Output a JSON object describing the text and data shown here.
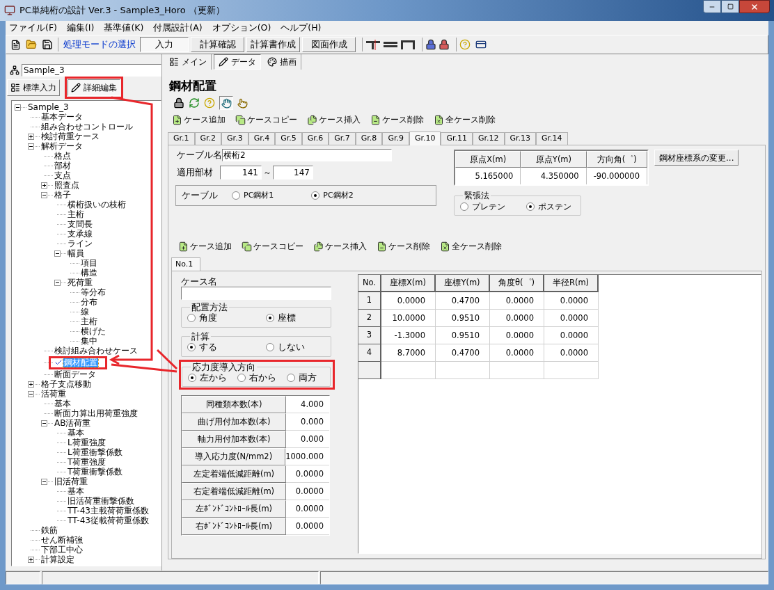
{
  "window": {
    "title": "PC単純桁の設計 Ver.3 - Sample3_Horo （更新）"
  },
  "menu": [
    "ファイル(F)",
    "編集(I)",
    "基準値(K)",
    "付属設計(A)",
    "オプション(O)",
    "ヘルプ(H)"
  ],
  "toolbar": {
    "mode_label": "処理モードの選択",
    "modes": [
      {
        "label": "入力",
        "selected": true
      },
      {
        "label": "計算確認",
        "selected": false
      },
      {
        "label": "計算書作成",
        "selected": false
      },
      {
        "label": "図面作成",
        "selected": false
      }
    ]
  },
  "left_panel": {
    "project": "Sample_3",
    "view_buttons": [
      {
        "label": "標準入力",
        "selected": false
      },
      {
        "label": "詳細編集",
        "selected": true
      }
    ],
    "tree": [
      {
        "label": "Sample_3",
        "kind": "branch",
        "expanded": true,
        "selected": false,
        "checked": false,
        "children": [
          {
            "label": "基本データ",
            "kind": "leaf",
            "selected": false,
            "checked": false
          },
          {
            "label": "組み合わせコントロール",
            "kind": "leaf",
            "selected": false,
            "checked": false
          },
          {
            "label": "検討荷重ケース",
            "kind": "branch",
            "expanded": false,
            "selected": false,
            "checked": false
          },
          {
            "label": "解析データ",
            "kind": "branch",
            "expanded": true,
            "selected": false,
            "checked": false,
            "children": [
              {
                "label": "格点",
                "kind": "leaf",
                "selected": false,
                "checked": false
              },
              {
                "label": "部材",
                "kind": "leaf",
                "selected": false,
                "checked": false
              },
              {
                "label": "支点",
                "kind": "leaf",
                "selected": false,
                "checked": false
              },
              {
                "label": "照査点",
                "kind": "branch",
                "expanded": false,
                "selected": false,
                "checked": false
              },
              {
                "label": "格子",
                "kind": "branch",
                "expanded": true,
                "selected": false,
                "checked": false,
                "children": [
                  {
                    "label": "横桁扱いの枝桁",
                    "kind": "leaf",
                    "selected": false,
                    "checked": false
                  },
                  {
                    "label": "主桁",
                    "kind": "leaf",
                    "selected": false,
                    "checked": false
                  },
                  {
                    "label": "支間長",
                    "kind": "leaf",
                    "selected": false,
                    "checked": false
                  },
                  {
                    "label": "支承線",
                    "kind": "leaf",
                    "selected": false,
                    "checked": false
                  },
                  {
                    "label": "ライン",
                    "kind": "leaf",
                    "selected": false,
                    "checked": false
                  },
                  {
                    "label": "幅員",
                    "kind": "branch",
                    "expanded": true,
                    "selected": false,
                    "checked": false,
                    "children": [
                      {
                        "label": "項目",
                        "kind": "leaf",
                        "selected": false,
                        "checked": false
                      },
                      {
                        "label": "構造",
                        "kind": "leaf",
                        "selected": false,
                        "checked": false
                      }
                    ]
                  },
                  {
                    "label": "死荷重",
                    "kind": "branch",
                    "expanded": true,
                    "selected": false,
                    "checked": false,
                    "children": [
                      {
                        "label": "等分布",
                        "kind": "leaf",
                        "selected": false,
                        "checked": false
                      },
                      {
                        "label": "分布",
                        "kind": "leaf",
                        "selected": false,
                        "checked": false
                      },
                      {
                        "label": "線",
                        "kind": "leaf",
                        "selected": false,
                        "checked": false
                      },
                      {
                        "label": "主桁",
                        "kind": "leaf",
                        "selected": false,
                        "checked": false
                      },
                      {
                        "label": "横げた",
                        "kind": "leaf",
                        "selected": false,
                        "checked": false
                      },
                      {
                        "label": "集中",
                        "kind": "leaf",
                        "selected": false,
                        "checked": false
                      }
                    ]
                  }
                ]
              },
              {
                "label": "検討組み合わせケース",
                "kind": "leaf",
                "selected": false,
                "checked": false
              },
              {
                "label": "鋼材配置",
                "kind": "leaf",
                "selected": true,
                "checked": true
              },
              {
                "label": "断面データ",
                "kind": "leaf",
                "selected": false,
                "checked": false
              }
            ]
          },
          {
            "label": "格子支点移動",
            "kind": "branch",
            "expanded": false,
            "selected": false,
            "checked": false
          },
          {
            "label": "活荷重",
            "kind": "branch",
            "expanded": true,
            "selected": false,
            "checked": false,
            "children": [
              {
                "label": "基本",
                "kind": "leaf",
                "selected": false,
                "checked": false
              },
              {
                "label": "断面力算出用荷重強度",
                "kind": "leaf",
                "selected": false,
                "checked": false
              },
              {
                "label": "AB活荷重",
                "kind": "branch",
                "expanded": true,
                "selected": false,
                "checked": false,
                "children": [
                  {
                    "label": "基本",
                    "kind": "leaf",
                    "selected": false,
                    "checked": false
                  },
                  {
                    "label": "L荷重強度",
                    "kind": "leaf",
                    "selected": false,
                    "checked": false
                  },
                  {
                    "label": "L荷重衝撃係数",
                    "kind": "leaf",
                    "selected": false,
                    "checked": false
                  },
                  {
                    "label": "T荷重強度",
                    "kind": "leaf",
                    "selected": false,
                    "checked": false
                  },
                  {
                    "label": "T荷重衝撃係数",
                    "kind": "leaf",
                    "selected": false,
                    "checked": false
                  }
                ]
              },
              {
                "label": "旧活荷重",
                "kind": "branch",
                "expanded": true,
                "selected": false,
                "checked": false,
                "children": [
                  {
                    "label": "基本",
                    "kind": "leaf",
                    "selected": false,
                    "checked": false
                  },
                  {
                    "label": "旧活荷重衝撃係数",
                    "kind": "leaf",
                    "selected": false,
                    "checked": false
                  },
                  {
                    "label": "TT-43主載荷荷重係数",
                    "kind": "leaf",
                    "selected": false,
                    "checked": false
                  },
                  {
                    "label": "TT-43従載荷荷重係数",
                    "kind": "leaf",
                    "selected": false,
                    "checked": false
                  }
                ]
              }
            ]
          },
          {
            "label": "鉄筋",
            "kind": "leaf",
            "selected": false,
            "checked": false
          },
          {
            "label": "せん断補強",
            "kind": "leaf",
            "selected": false,
            "checked": false
          },
          {
            "label": "下部工中心",
            "kind": "leaf",
            "selected": false,
            "checked": false
          },
          {
            "label": "計算設定",
            "kind": "branch",
            "expanded": false,
            "selected": false,
            "checked": false
          }
        ]
      }
    ]
  },
  "main_tabs": [
    {
      "label": "メイン",
      "selected": false
    },
    {
      "label": "データ",
      "selected": true
    },
    {
      "label": "描画",
      "selected": false
    }
  ],
  "section_title": "鋼材配置",
  "case_toolbar": [
    "ケース追加",
    "ケースコピー",
    "ケース挿入",
    "ケース削除",
    "全ケース削除"
  ],
  "group_tabs": [
    {
      "label": "Gr.1",
      "selected": false
    },
    {
      "label": "Gr.2",
      "selected": false
    },
    {
      "label": "Gr.3",
      "selected": false
    },
    {
      "label": "Gr.4",
      "selected": false
    },
    {
      "label": "Gr.5",
      "selected": false
    },
    {
      "label": "Gr.6",
      "selected": false
    },
    {
      "label": "Gr.7",
      "selected": false
    },
    {
      "label": "Gr.8",
      "selected": false
    },
    {
      "label": "Gr.9",
      "selected": false
    },
    {
      "label": "Gr.10",
      "selected": true
    },
    {
      "label": "Gr.11",
      "selected": false
    },
    {
      "label": "Gr.12",
      "selected": false
    },
    {
      "label": "Gr.13",
      "selected": false
    },
    {
      "label": "Gr.14",
      "selected": false
    }
  ],
  "cable_name": {
    "label": "ケーブル名",
    "value": "横桁2"
  },
  "members": {
    "label": "適用部材",
    "from": "141",
    "separator": "～",
    "to": "147"
  },
  "cable": {
    "label": "ケーブル",
    "options": [
      {
        "label": "PC鋼材1",
        "selected": false
      },
      {
        "label": "PC鋼材2",
        "selected": true
      }
    ]
  },
  "origin_table": {
    "columns": [
      "原点X(m)",
      "原点Y(m)",
      "方向角(゜)"
    ],
    "values": [
      "5.165000",
      "4.350000",
      "-90.000000"
    ]
  },
  "change_button": "鋼材座標系の変更...",
  "tension": {
    "title": "緊張法",
    "options": [
      {
        "label": "プレテン",
        "selected": false
      },
      {
        "label": "ポステン",
        "selected": true
      }
    ]
  },
  "case_toolbar_2": [
    "ケース追加",
    "ケースコピー",
    "ケース挿入",
    "ケース削除",
    "全ケース削除"
  ],
  "case_tabs": [
    {
      "label": "No.1",
      "selected": true
    }
  ],
  "case_name": {
    "label": "ケース名"
  },
  "placement": {
    "title": "配置方法",
    "options": [
      {
        "label": "角度",
        "selected": false
      },
      {
        "label": "座標",
        "selected": true
      }
    ]
  },
  "calculation": {
    "title": "計算",
    "options": [
      {
        "label": "する",
        "selected": true
      },
      {
        "label": "しない",
        "selected": false
      }
    ]
  },
  "direction": {
    "title": "応力度導入方向",
    "options": [
      {
        "label": "左から",
        "selected": true
      },
      {
        "label": "右から",
        "selected": false
      },
      {
        "label": "両方",
        "selected": false
      }
    ]
  },
  "properties": [
    {
      "label": "同種類本数(本)",
      "value": "4.000"
    },
    {
      "label": "曲げ用付加本数(本)",
      "value": "0.000"
    },
    {
      "label": "軸力用付加本数(本)",
      "value": "0.000"
    },
    {
      "label": "導入応力度(N/mm2)",
      "value": "1000.000"
    },
    {
      "label": "左定着端低減距離(m)",
      "value": "0.0000"
    },
    {
      "label": "右定着端低減距離(m)",
      "value": "0.0000"
    },
    {
      "label": "左ﾎﾞﾝﾄﾞｺﾝﾄﾛｰﾙ長(m)",
      "value": "0.0000"
    },
    {
      "label": "右ﾎﾞﾝﾄﾞｺﾝﾄﾛｰﾙ長(m)",
      "value": "0.0000"
    }
  ],
  "coords_table": {
    "columns": [
      "No.",
      "座標X(m)",
      "座標Y(m)",
      "角度θ(゜)",
      "半径R(m)"
    ],
    "rows": [
      [
        "1",
        "0.0000",
        "0.4700",
        "0.0000",
        "0.0000"
      ],
      [
        "2",
        "10.0000",
        "0.9510",
        "0.0000",
        "0.0000"
      ],
      [
        "3",
        "-1.3000",
        "0.9510",
        "0.0000",
        "0.0000"
      ],
      [
        "4",
        "8.7000",
        "0.4700",
        "0.0000",
        "0.0000"
      ]
    ]
  }
}
